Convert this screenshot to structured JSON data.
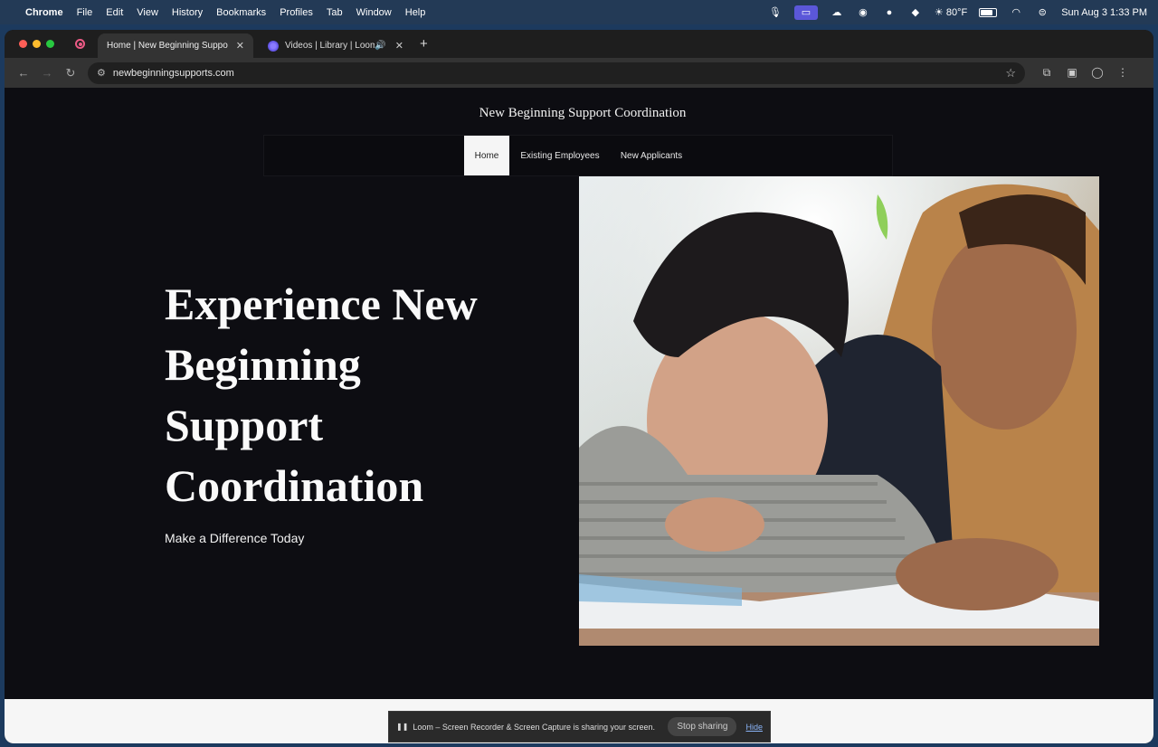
{
  "menubar": {
    "app_name": "Chrome",
    "items": [
      "File",
      "Edit",
      "View",
      "History",
      "Bookmarks",
      "Profiles",
      "Tab",
      "Window",
      "Help"
    ],
    "weather": "80°F",
    "datetime": "Sun Aug 3  1:33 PM"
  },
  "browser": {
    "tabs": [
      {
        "title": "Home | New Beginning Suppo",
        "active": true
      },
      {
        "title": "Videos | Library | Loom",
        "active": false
      }
    ],
    "url": "newbeginningsupports.com"
  },
  "site": {
    "title": "New Beginning Support Coordination",
    "nav": [
      "Home",
      "Existing Employees",
      "New Applicants"
    ],
    "hero_title_lines": [
      "Experience New",
      "Beginning",
      "Support",
      "Coordination"
    ],
    "hero_subtitle": "Make a Difference Today"
  },
  "loom": {
    "message": "Loom – Screen Recorder & Screen Capture is sharing your screen.",
    "stop_label": "Stop sharing",
    "hide_label": "Hide"
  },
  "colors": {
    "page_bg": "#0d0d12",
    "nav_active_bg": "#f5f5f5",
    "loom_link": "#8ab4f8"
  }
}
